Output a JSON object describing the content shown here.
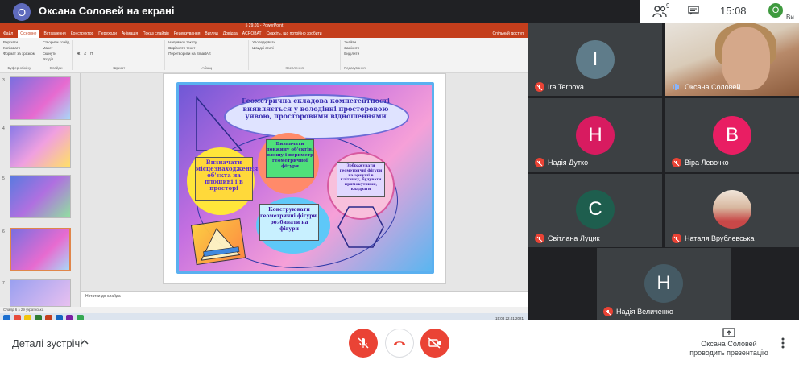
{
  "header": {
    "presenter_initial": "О",
    "title": "Оксана Соловей на екрані",
    "people_count": "9",
    "time": "15:08",
    "self_initial": "О",
    "self_label": "Ви"
  },
  "powerpoint": {
    "window_title": "5 29.01 - PowerPoint",
    "tabs": [
      "Файл",
      "Основне",
      "Вставлення",
      "Конструктор",
      "Переходи",
      "Анімація",
      "Показ слайдів",
      "Рецензування",
      "Вигляд",
      "Довідка",
      "ACROBAT",
      "Скажіть, що потрібно зробити"
    ],
    "active_tab": "Основне",
    "share_label": "Спільний доступ",
    "ribbon_groups": [
      {
        "label": "Буфер обміну",
        "items": [
          "Вирізати",
          "Копіювати",
          "Формат за зразком"
        ]
      },
      {
        "label": "Слайди",
        "items": [
          "Створити слайд",
          "Макет",
          "Скинути",
          "Розділ"
        ]
      },
      {
        "label": "Шрифт",
        "items": [
          "Ж",
          "К",
          "П"
        ]
      },
      {
        "label": "Абзац",
        "items": [
          "Напрямок тексту",
          "Вирівняти текст",
          "Перетворити на SmartArt"
        ]
      },
      {
        "label": "Креслення",
        "items": [
          "Упорядкувати",
          "Швидкі стилі"
        ]
      },
      {
        "label": "Редагування",
        "items": [
          "Знайти",
          "Замінити",
          "Виділити"
        ]
      }
    ],
    "thumb_numbers": [
      "3",
      "4",
      "5",
      "6",
      "7"
    ],
    "slide": {
      "title": "Геометрична складова компетентності виявляється у володінні просторовою уявою, просторовими відношеннями",
      "box_yellow": "Визначати місцезнаходження об'єкта на площині і в просторі",
      "box_green": "Визначати довжину об'єктів, площу і периметр геометричної фігури",
      "box_pink": "Зображувати геометричні фігури на аркуші в клітинку, будувати прямокутники, квадрати",
      "box_blue": "Конструювати геометричні фігури, розбивати на фігури"
    },
    "notes_placeholder": "Нотатки до слайда",
    "status_text": "Слайд 6 з 29   українська",
    "taskbar_clock": "15:08 22.01.2021"
  },
  "participants": [
    {
      "name": "Ira Ternova",
      "initial": "I",
      "color": "#5f7c8a"
    },
    {
      "name": "Оксана Соловей",
      "initial": "",
      "color": ""
    },
    {
      "name": "Надія Дутко",
      "initial": "Н",
      "color": "#d81b60"
    },
    {
      "name": "Віра Левочко",
      "initial": "В",
      "color": "#e91e63"
    },
    {
      "name": "Світлана Луцик",
      "initial": "С",
      "color": "#1e5e4e"
    },
    {
      "name": "Наталя Врублевська",
      "initial": "",
      "color": ""
    },
    {
      "name": "Надія Величенко",
      "initial": "Н",
      "color": "#455a64"
    }
  ],
  "bottombar": {
    "details_label": "Деталі зустрічі",
    "presenting_line1": "Оксана Соловей",
    "presenting_line2": "проводить презентацію"
  },
  "colors": {
    "accent_red": "#ea4335",
    "ppt_orange": "#c43e1c",
    "meet_dark": "#202124"
  }
}
